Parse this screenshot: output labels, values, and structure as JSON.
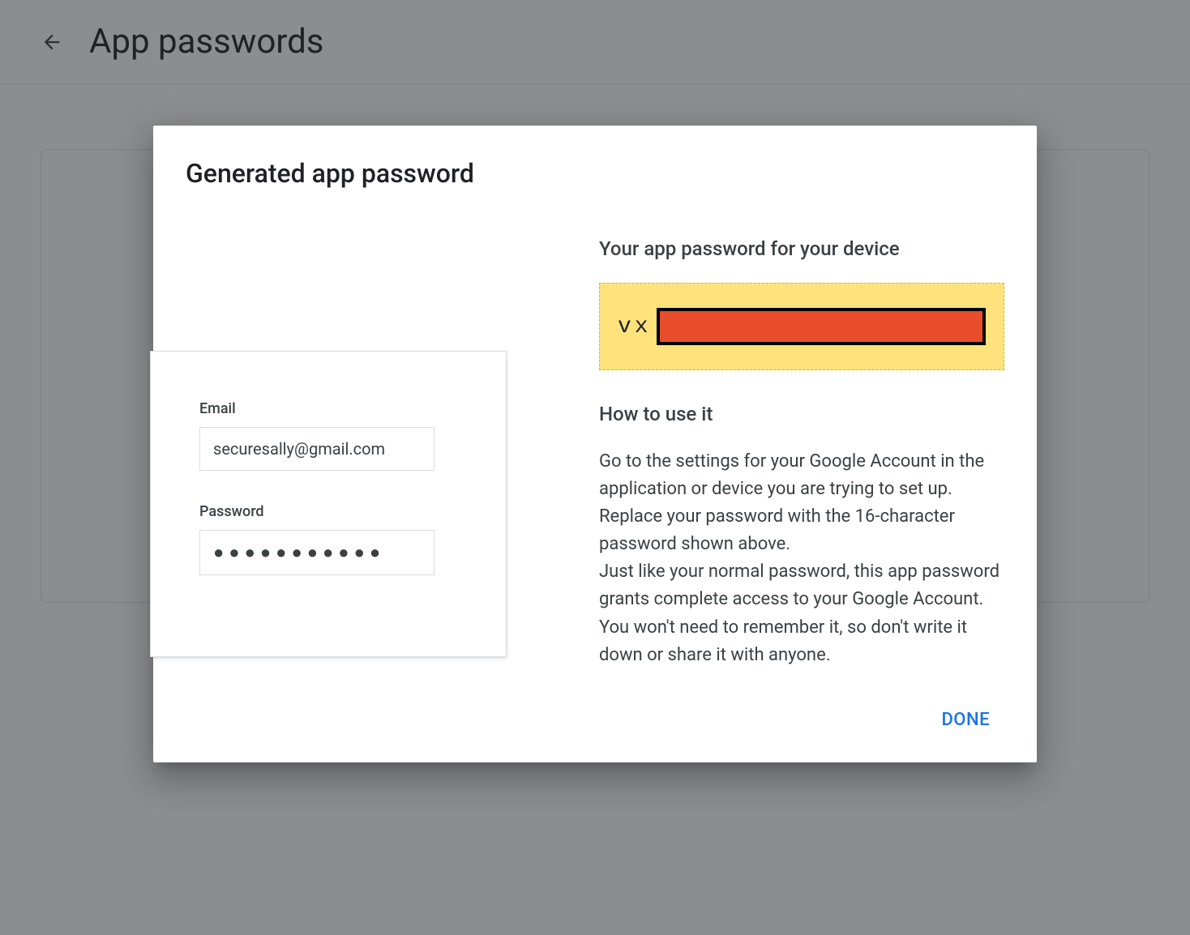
{
  "header": {
    "title": "App passwords"
  },
  "modal": {
    "title": "Generated app password",
    "illustration": {
      "email_label": "Email",
      "email_value": "securesally@gmail.com",
      "password_label": "Password",
      "password_value": "●●●●●●●●●●●"
    },
    "right": {
      "heading1": "Your app password for your device",
      "password_prefix": "vx",
      "heading2": "How to use it",
      "instructions_p1": "Go to the settings for your Google Account in the application or device you are trying to set up. Replace your password with the 16-character password shown above.",
      "instructions_p2": "Just like your normal password, this app password grants complete access to your Google Account. You won't need to remember it, so don't write it down or share it with anyone."
    },
    "actions": {
      "done": "DONE"
    }
  }
}
